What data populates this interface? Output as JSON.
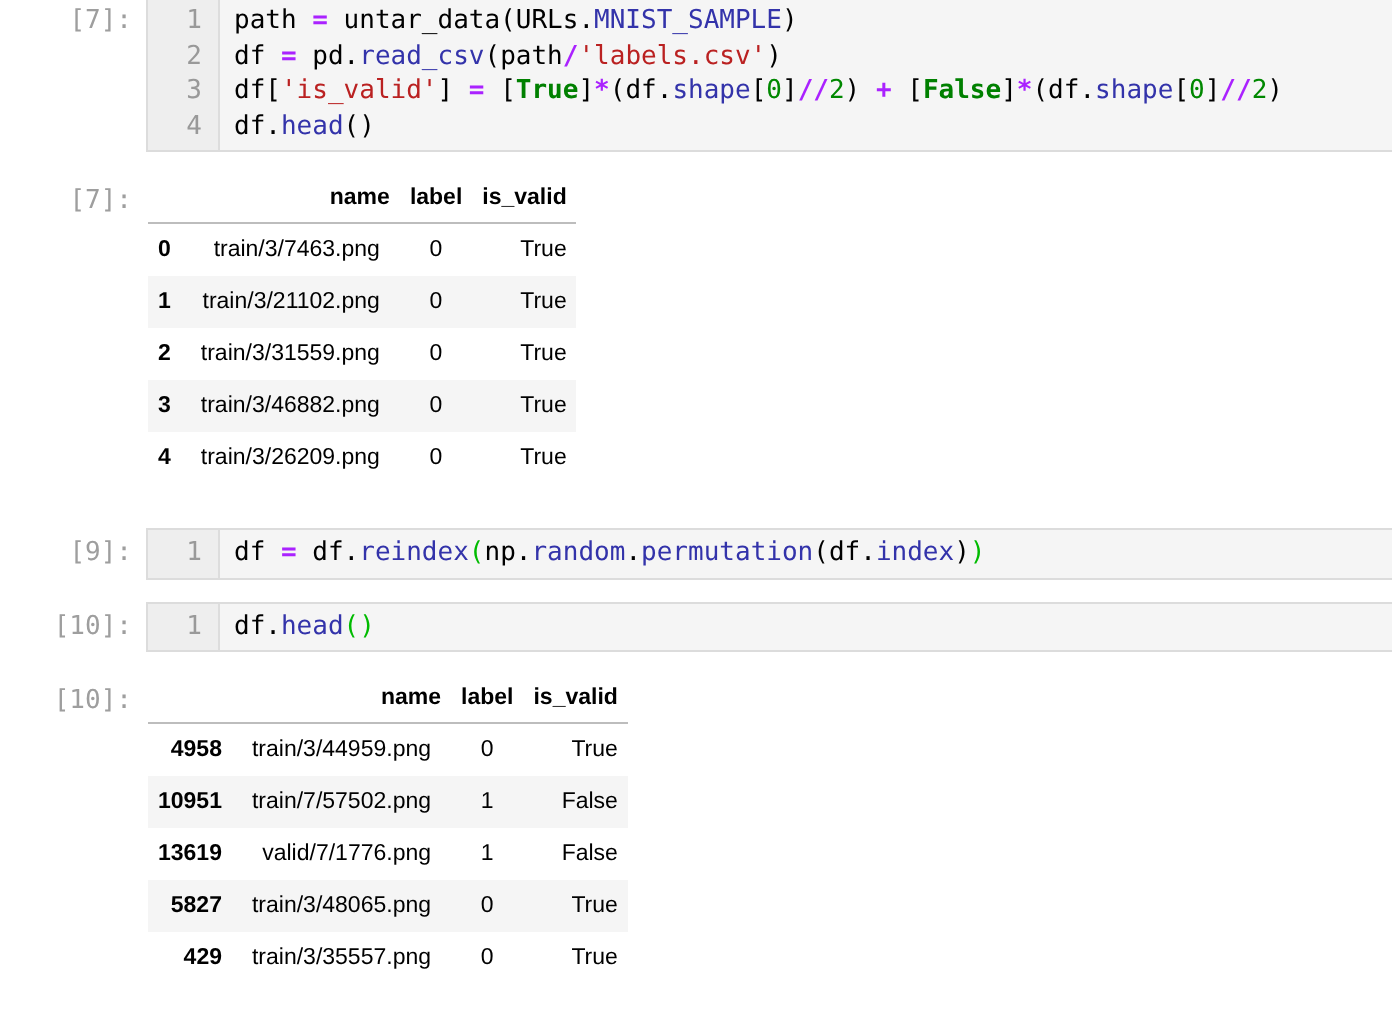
{
  "cells": [
    {
      "kind": "code",
      "prompt": "[7]:",
      "lines": [
        {
          "number": "1",
          "tokens": [
            {
              "kind": "plain",
              "text": "path "
            },
            {
              "kind": "op",
              "text": "="
            },
            {
              "kind": "plain",
              "text": " untar_data(URLs."
            },
            {
              "kind": "prop",
              "text": "MNIST_SAMPLE"
            },
            {
              "kind": "plain",
              "text": ")"
            }
          ]
        },
        {
          "number": "2",
          "tokens": [
            {
              "kind": "plain",
              "text": "df "
            },
            {
              "kind": "op",
              "text": "="
            },
            {
              "kind": "plain",
              "text": " pd."
            },
            {
              "kind": "prop",
              "text": "read_csv"
            },
            {
              "kind": "plain",
              "text": "(path"
            },
            {
              "kind": "op",
              "text": "/"
            },
            {
              "kind": "string",
              "text": "'labels.csv'"
            },
            {
              "kind": "plain",
              "text": ")"
            }
          ]
        },
        {
          "number": "3",
          "tokens": [
            {
              "kind": "plain",
              "text": "df["
            },
            {
              "kind": "string",
              "text": "'is_valid'"
            },
            {
              "kind": "plain",
              "text": "] "
            },
            {
              "kind": "op",
              "text": "="
            },
            {
              "kind": "plain",
              "text": " ["
            },
            {
              "kind": "keyword",
              "text": "True"
            },
            {
              "kind": "plain",
              "text": "]"
            },
            {
              "kind": "op",
              "text": "*"
            },
            {
              "kind": "plain",
              "text": "(df."
            },
            {
              "kind": "prop",
              "text": "shape"
            },
            {
              "kind": "plain",
              "text": "["
            },
            {
              "kind": "number",
              "text": "0"
            },
            {
              "kind": "plain",
              "text": "]"
            },
            {
              "kind": "op",
              "text": "//"
            },
            {
              "kind": "number",
              "text": "2"
            },
            {
              "kind": "plain",
              "text": ") "
            },
            {
              "kind": "op",
              "text": "+"
            },
            {
              "kind": "plain",
              "text": " ["
            },
            {
              "kind": "keyword",
              "text": "False"
            },
            {
              "kind": "plain",
              "text": "]"
            },
            {
              "kind": "op",
              "text": "*"
            },
            {
              "kind": "plain",
              "text": "(df."
            },
            {
              "kind": "prop",
              "text": "shape"
            },
            {
              "kind": "plain",
              "text": "["
            },
            {
              "kind": "number",
              "text": "0"
            },
            {
              "kind": "plain",
              "text": "]"
            },
            {
              "kind": "op",
              "text": "//"
            },
            {
              "kind": "number",
              "text": "2"
            },
            {
              "kind": "plain",
              "text": ")"
            }
          ]
        },
        {
          "number": "4",
          "tokens": [
            {
              "kind": "plain",
              "text": "df."
            },
            {
              "kind": "prop",
              "text": "head"
            },
            {
              "kind": "plain",
              "text": "()"
            }
          ]
        }
      ]
    },
    {
      "kind": "table",
      "prompt": "[7]:",
      "columns": [
        "name",
        "label",
        "is_valid"
      ],
      "rows": [
        {
          "index": "0",
          "cells": [
            "train/3/7463.png",
            "0",
            "True"
          ]
        },
        {
          "index": "1",
          "cells": [
            "train/3/21102.png",
            "0",
            "True"
          ]
        },
        {
          "index": "2",
          "cells": [
            "train/3/31559.png",
            "0",
            "True"
          ]
        },
        {
          "index": "3",
          "cells": [
            "train/3/46882.png",
            "0",
            "True"
          ]
        },
        {
          "index": "4",
          "cells": [
            "train/3/26209.png",
            "0",
            "True"
          ]
        }
      ]
    },
    {
      "kind": "code",
      "prompt": "[9]:",
      "lines": [
        {
          "number": "1",
          "tokens": [
            {
              "kind": "plain",
              "text": "df "
            },
            {
              "kind": "op",
              "text": "="
            },
            {
              "kind": "plain",
              "text": " df."
            },
            {
              "kind": "prop",
              "text": "reindex"
            },
            {
              "kind": "match",
              "text": "("
            },
            {
              "kind": "plain",
              "text": "np."
            },
            {
              "kind": "prop",
              "text": "random"
            },
            {
              "kind": "plain",
              "text": "."
            },
            {
              "kind": "prop",
              "text": "permutation"
            },
            {
              "kind": "plain",
              "text": "(df."
            },
            {
              "kind": "prop",
              "text": "index"
            },
            {
              "kind": "plain",
              "text": ")"
            },
            {
              "kind": "match",
              "text": ")"
            }
          ]
        }
      ]
    },
    {
      "kind": "code",
      "prompt": "[10]:",
      "lines": [
        {
          "number": "1",
          "tokens": [
            {
              "kind": "plain",
              "text": "df."
            },
            {
              "kind": "prop",
              "text": "head"
            },
            {
              "kind": "match",
              "text": "()"
            }
          ]
        }
      ]
    },
    {
      "kind": "table",
      "prompt": "[10]:",
      "columns": [
        "name",
        "label",
        "is_valid"
      ],
      "rows": [
        {
          "index": "4958",
          "cells": [
            "train/3/44959.png",
            "0",
            "True"
          ]
        },
        {
          "index": "10951",
          "cells": [
            "train/7/57502.png",
            "1",
            "False"
          ]
        },
        {
          "index": "13619",
          "cells": [
            "valid/7/1776.png",
            "1",
            "False"
          ]
        },
        {
          "index": "5827",
          "cells": [
            "train/3/48065.png",
            "0",
            "True"
          ]
        },
        {
          "index": "429",
          "cells": [
            "train/3/35557.png",
            "0",
            "True"
          ]
        }
      ]
    }
  ]
}
